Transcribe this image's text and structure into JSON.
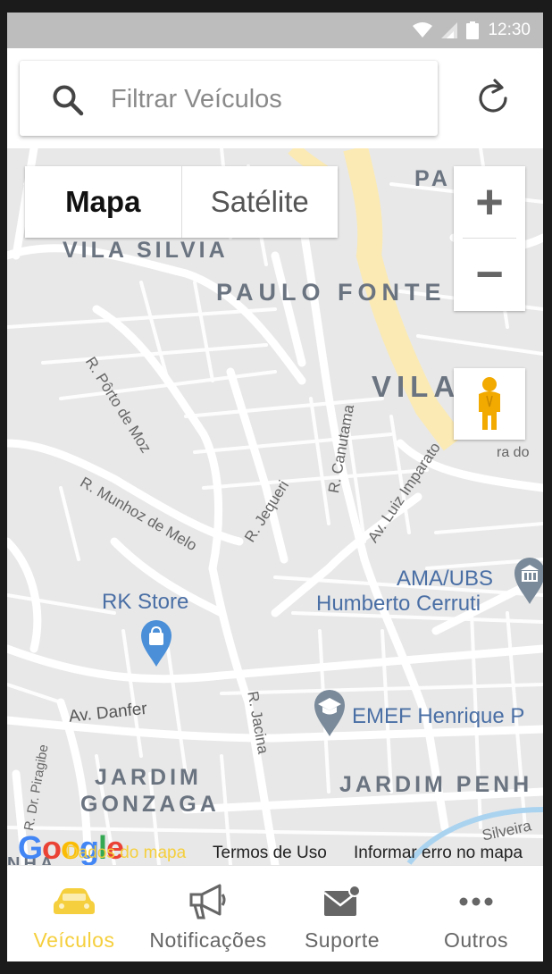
{
  "status_bar": {
    "time": "12:30"
  },
  "search": {
    "placeholder": "Filtrar Veículos"
  },
  "map": {
    "map_type": {
      "map": "Mapa",
      "satellite": "Satélite",
      "selected": "Mapa"
    },
    "zoom": {
      "in": "+",
      "out": "−"
    },
    "neighborhoods": [
      "VILA SILVIA",
      "PAULO FONTE",
      "VILA S",
      "JARDIM",
      "GONZAGA",
      "JARDIM PENH",
      "PA",
      "NHA"
    ],
    "streets": [
      "R. Pôrto de Moz",
      "R. Munhoz de Melo",
      "R. Jequeri",
      "R. Canutama",
      "Av. Luiz Imparato",
      "Av. Danfer",
      "R. Jacina",
      "R. Dr. Piragibe",
      "Silveira",
      "ra do"
    ],
    "pois": [
      {
        "name": "RK Store",
        "icon": "shopping-bag-icon"
      },
      {
        "name": "AMA/UBS",
        "name2": "Humberto Cerruti",
        "icon": "hospital-icon"
      },
      {
        "name": "EMEF Henrique P",
        "icon": "school-icon"
      }
    ],
    "attribution": {
      "logo": "Google",
      "data": "Dados do mapa",
      "terms": "Termos de Uso",
      "report": "Informar erro no mapa"
    }
  },
  "bottom_nav": [
    {
      "label": "Veículos",
      "icon": "car-icon",
      "active": true
    },
    {
      "label": "Notificações",
      "icon": "megaphone-icon",
      "active": false
    },
    {
      "label": "Suporte",
      "icon": "mail-icon",
      "active": false
    },
    {
      "label": "Outros",
      "icon": "more-dots-icon",
      "active": false
    }
  ],
  "colors": {
    "accent": "#f5cf3d",
    "status_bar": "#bdbdbd",
    "map_bg": "#e8e8e8",
    "poi_blue": "#4a8fd8",
    "poi_gray": "#7a8a9a"
  }
}
